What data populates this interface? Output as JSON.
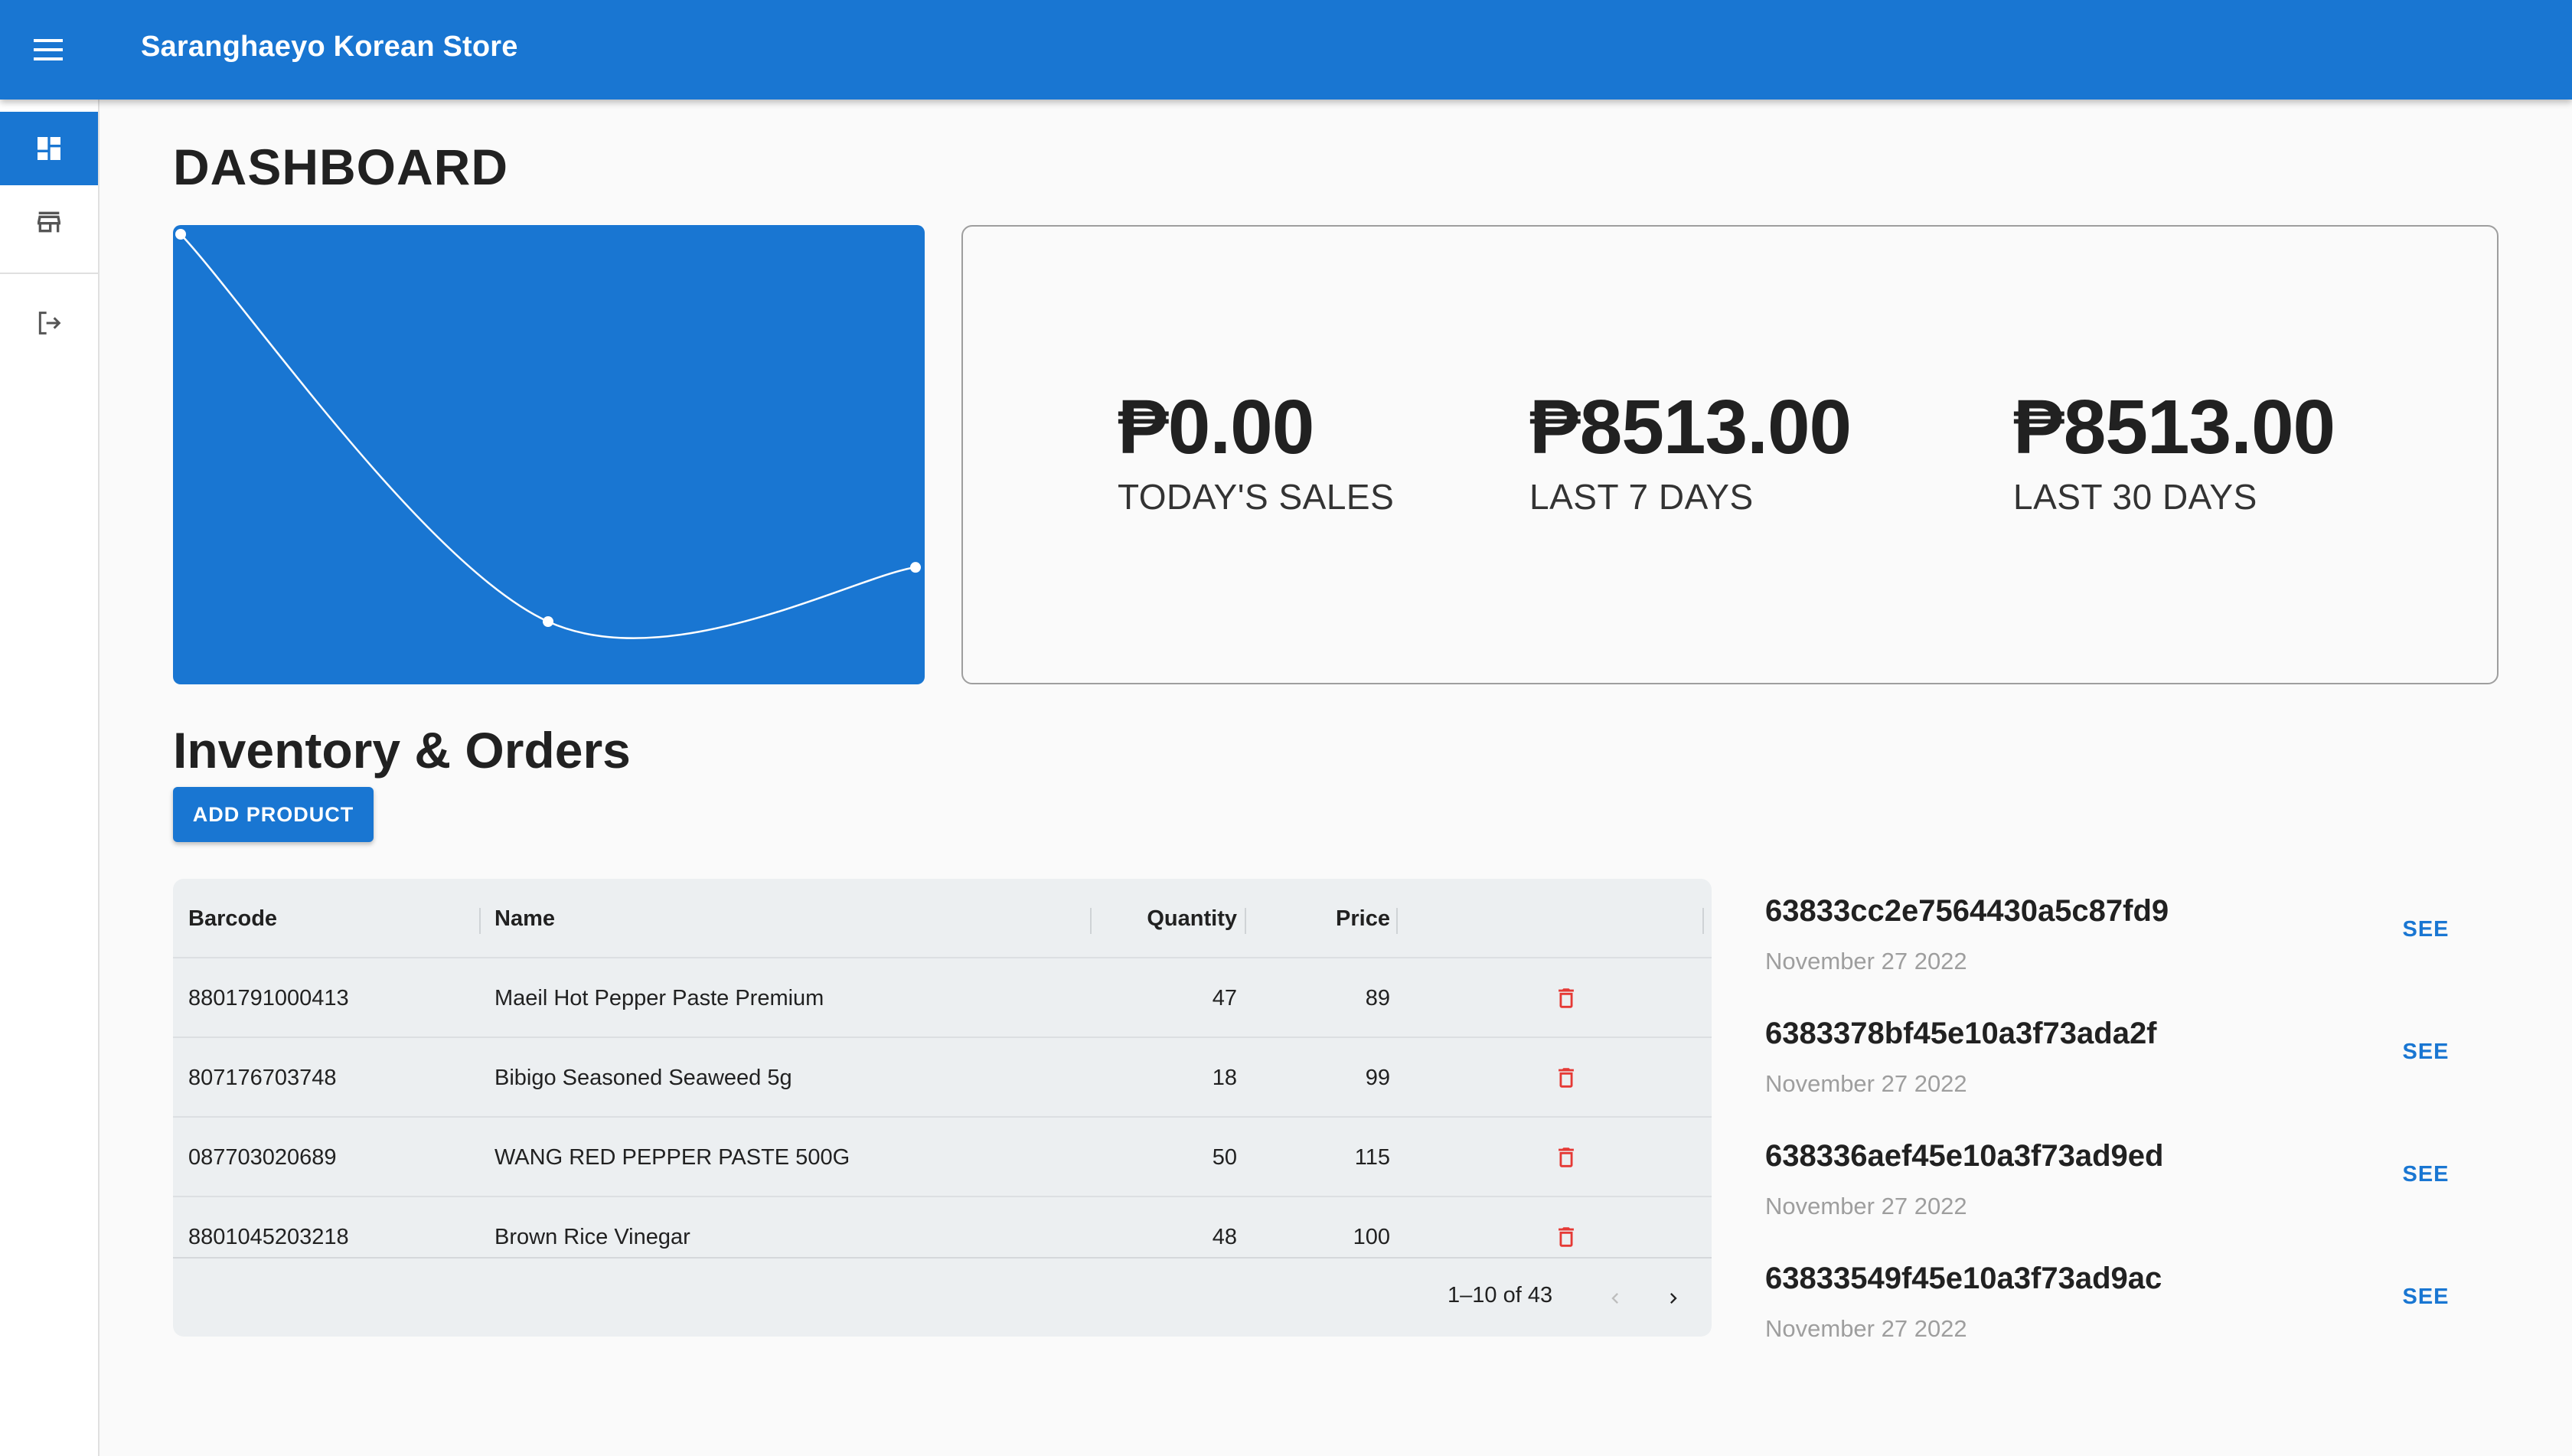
{
  "app": {
    "title": "Saranghaeyo Korean Store"
  },
  "rail": {
    "items": [
      {
        "icon": "dashboard-icon",
        "active": true
      },
      {
        "icon": "store-icon",
        "active": false
      },
      {
        "icon": "logout-icon",
        "active": false
      }
    ]
  },
  "page": {
    "title": "DASHBOARD"
  },
  "chart_data": {
    "type": "line",
    "x": [
      0,
      1,
      2
    ],
    "values": [
      1.0,
      0.0,
      0.14
    ],
    "title": "",
    "xlabel": "",
    "ylabel": "",
    "grid": false,
    "color": "#ffffff",
    "background": "#1976d2"
  },
  "stats": [
    {
      "value": "₱0.00",
      "label": "TODAY'S SALES"
    },
    {
      "value": "₱8513.00",
      "label": "LAST 7 DAYS"
    },
    {
      "value": "₱8513.00",
      "label": "LAST 30 DAYS"
    }
  ],
  "inventory": {
    "title": "Inventory & Orders",
    "add_button": "ADD PRODUCT",
    "columns": {
      "barcode": "Barcode",
      "name": "Name",
      "quantity": "Quantity",
      "price": "Price"
    },
    "rows": [
      {
        "barcode": "8801791000413",
        "name": "Maeil Hot Pepper Paste Premium",
        "quantity": "47",
        "price": "89"
      },
      {
        "barcode": "807176703748",
        "name": "Bibigo Seasoned Seaweed 5g",
        "quantity": "18",
        "price": "99"
      },
      {
        "barcode": "087703020689",
        "name": "WANG RED PEPPER PASTE 500G",
        "quantity": "50",
        "price": "115"
      },
      {
        "barcode": "8801045203218",
        "name": "Brown Rice Vinegar",
        "quantity": "48",
        "price": "100"
      }
    ],
    "pagination": "1–10 of 43"
  },
  "orders": [
    {
      "id": "63833cc2e7564430a5c87fd9",
      "date": "November 27 2022",
      "action": "SEE"
    },
    {
      "id": "6383378bf45e10a3f73ada2f",
      "date": "November 27 2022",
      "action": "SEE"
    },
    {
      "id": "638336aef45e10a3f73ad9ed",
      "date": "November 27 2022",
      "action": "SEE"
    },
    {
      "id": "63833549f45e10a3f73ad9ac",
      "date": "November 27 2022",
      "action": "SEE"
    }
  ],
  "colors": {
    "primary": "#1976d2",
    "delete": "#e53935",
    "muted": "#9e9e9e"
  }
}
